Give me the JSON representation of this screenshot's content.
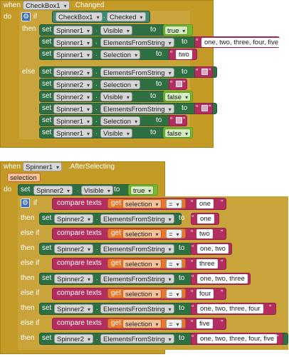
{
  "event1": {
    "when": "when",
    "component": "CheckBox1",
    "event": ".Changed",
    "do": "do",
    "if": "if",
    "cond_component": "CheckBox1",
    "cond_prop": "Checked",
    "then": "then",
    "else": "else",
    "then_rows": [
      {
        "comp": "Spinner1",
        "prop": "Visible",
        "value_type": "logic",
        "value": "true"
      },
      {
        "comp": "Spinner1",
        "prop": "ElementsFromString",
        "value_type": "text",
        "value": "one, two, three, four, five"
      },
      {
        "comp": "Spinner1",
        "prop": "Selection",
        "value_type": "text",
        "value": "two"
      }
    ],
    "else_rows": [
      {
        "comp": "Spinner2",
        "prop": "ElementsFromString",
        "value_type": "empty",
        "value": ""
      },
      {
        "comp": "Spinner2",
        "prop": "Selection",
        "value_type": "empty",
        "value": ""
      },
      {
        "comp": "Spinner2",
        "prop": "Visible",
        "value_type": "logic",
        "value": "false"
      },
      {
        "comp": "Spinner1",
        "prop": "ElementsFromString",
        "value_type": "empty",
        "value": ""
      },
      {
        "comp": "Spinner1",
        "prop": "Selection",
        "value_type": "empty",
        "value": ""
      },
      {
        "comp": "Spinner1",
        "prop": "Visible",
        "value_type": "logic",
        "value": "false"
      }
    ]
  },
  "event2": {
    "when": "when",
    "component": "Spinner1",
    "event": ".AfterSelecting",
    "param": "selection",
    "do": "do",
    "set_row": {
      "comp": "Spinner2",
      "prop": "Visible",
      "value": "true"
    },
    "if": "if",
    "else_if": "else if",
    "then": "then",
    "compare": "compare texts",
    "get": "get",
    "var": "selection",
    "op": "=",
    "cases": [
      {
        "match": "one",
        "result": "one"
      },
      {
        "match": "two",
        "result": "one, two"
      },
      {
        "match": "three",
        "result": "one, two, three"
      },
      {
        "match": "four",
        "result": "one, two, three, four"
      },
      {
        "match": "five",
        "result": "one, two, three, four, five"
      }
    ],
    "result_comp": "Spinner2",
    "result_prop": "ElementsFromString"
  },
  "common": {
    "set": "set",
    "to": "to",
    "dot": "."
  },
  "colors": {
    "event": "#c39a25",
    "setter": "#2f7043",
    "text": "#b32d5e",
    "logic": "#76b832",
    "variable": "#e7782c",
    "control": "#3e6fb6"
  },
  "icons": [
    "gear-icon"
  ]
}
